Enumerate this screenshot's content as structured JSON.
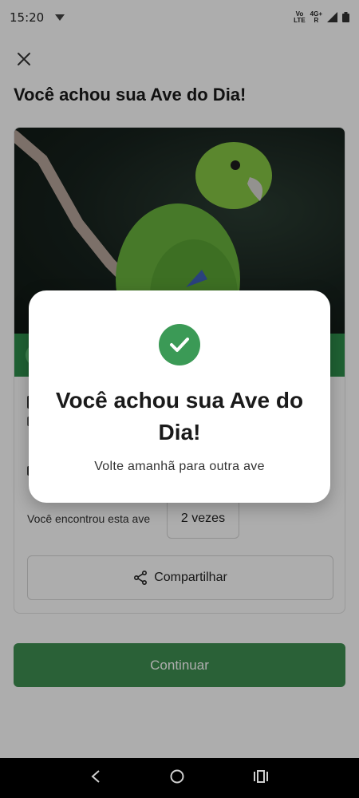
{
  "status_bar": {
    "time": "15:20",
    "network_top": "Vo",
    "network_bottom": "LTE",
    "network2_top": "4G+",
    "network2_bottom": "R"
  },
  "header": {
    "title": "Você achou sua Ave do Dia!"
  },
  "card": {
    "found_label": "Você encontrou esta ave",
    "found_count": "2 vezes",
    "share_label": "Compartilhar"
  },
  "footer": {
    "continue_label": "Continuar"
  },
  "dialog": {
    "title": "Você achou sua Ave do Dia!",
    "subtitle": "Volte amanhã para outra ave"
  },
  "colors": {
    "primary_green": "#3f8f52",
    "check_green": "#3b9a56"
  },
  "icons": [
    "close-icon",
    "share-icon",
    "check-icon",
    "back-icon",
    "home-icon",
    "recents-icon"
  ]
}
